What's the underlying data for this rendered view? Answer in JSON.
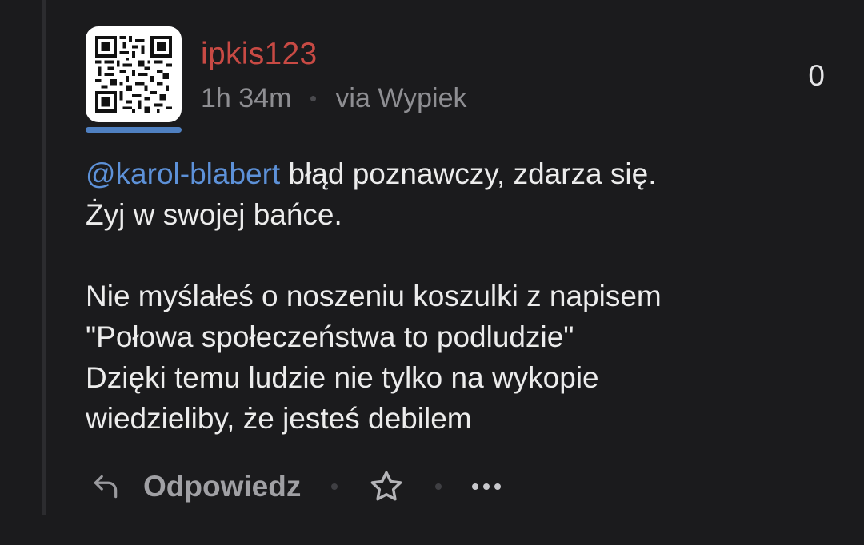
{
  "comment": {
    "author": "ipkis123",
    "time": "1h 34m",
    "via": "via Wypiek",
    "votes": "0",
    "mention": "@karol-blabert",
    "line1_rest": " błąd poznawczy, zdarza się.",
    "line2": "Żyj w swojej bańce.",
    "paragraph2": "Nie myślałeś o noszeniu koszulki z napisem\n\"Połowa społeczeństwa to podludzie\"\nDzięki temu ludzie nie tylko na wykopie\nwiedzieliby, że jesteś debilem"
  },
  "actions": {
    "reply_label": "Odpowiedz",
    "reply_icon": "reply-arrow-icon",
    "favorite_icon": "star-icon",
    "more_icon": "more-dots-icon"
  },
  "colors": {
    "background": "#1b1b1d",
    "author": "#c84a44",
    "mention": "#5d91d8",
    "accent_bar": "#4f80c1"
  }
}
